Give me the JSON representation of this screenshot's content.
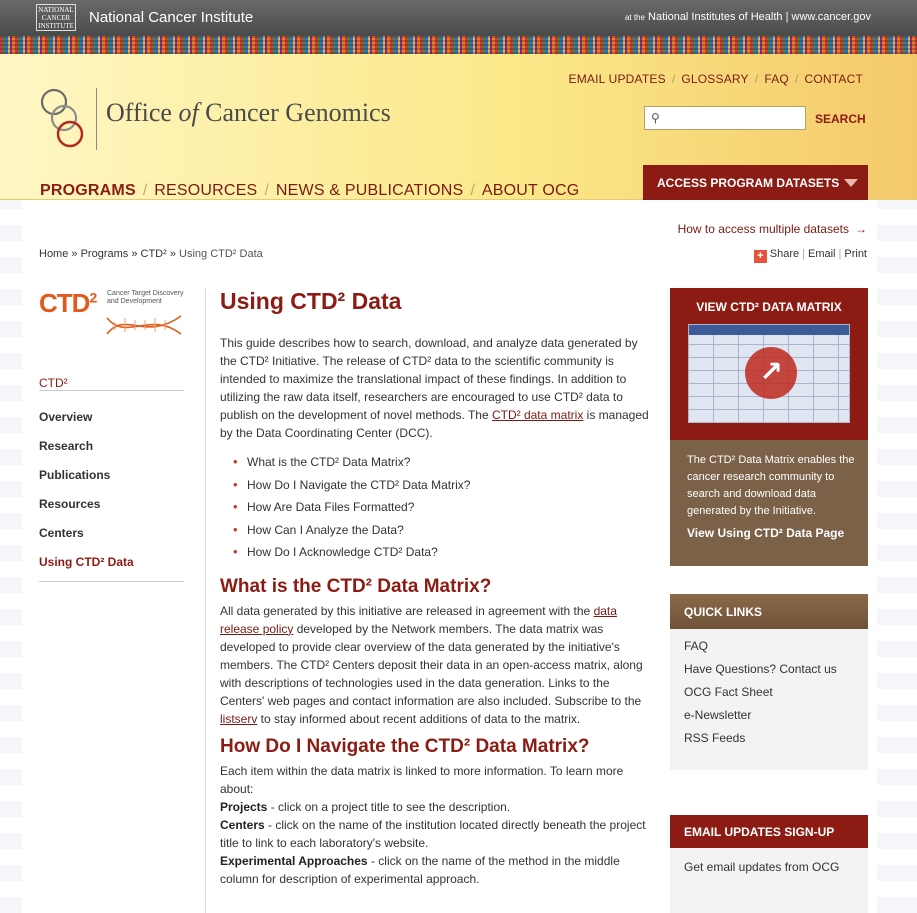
{
  "nci": {
    "logo_text": "NATIONAL CANCER INSTITUTE",
    "name": "National Cancer Institute",
    "nih_prefix": "at the",
    "nih_text": "National Institutes of Health | www.cancer.gov"
  },
  "header": {
    "utility_links": [
      "EMAIL UPDATES",
      "GLOSSARY",
      "FAQ",
      "CONTACT"
    ],
    "site_title_pre": "Office ",
    "site_title_of": "of",
    "site_title_post": " Cancer Genomics",
    "search_placeholder": "",
    "search_label": "SEARCH",
    "nav": [
      "PROGRAMS",
      "RESOURCES",
      "NEWS & PUBLICATIONS",
      "ABOUT OCG"
    ],
    "access_label": "ACCESS PROGRAM DATASETS"
  },
  "multi_link": "How to access multiple datasets",
  "breadcrumb": [
    "Home",
    "Programs",
    "CTD²",
    "Using CTD² Data"
  ],
  "share": {
    "share": "Share",
    "email": "Email",
    "print": "Print"
  },
  "left": {
    "logo_big": "CTD",
    "logo_sup": "2",
    "logo_sub": "Cancer Target Discovery and Development",
    "section_title": "CTD²",
    "items": [
      "Overview",
      "Research",
      "Publications",
      "Resources",
      "Centers",
      "Using CTD² Data"
    ]
  },
  "main": {
    "title": "Using CTD² Data",
    "intro_1": "This guide describes how to search, download, and analyze data generated by the CTD² Initiative. The release of CTD² data to the scientific community is intended to maximize the translational impact of these findings. In addition to utilizing the raw data itself, researchers are encouraged to use CTD² data to publish on the development of novel methods. The ",
    "intro_link": "CTD² data matrix",
    "intro_2": "  is managed by the Data Coordinating Center (DCC).",
    "toc": [
      "What is the CTD² Data Matrix?",
      "How Do I Navigate the CTD² Data Matrix?",
      "How Are Data Files Formatted?",
      "How Can I Analyze the Data?",
      "How Do I Acknowledge CTD² Data?"
    ],
    "h2_1": "What is the CTD² Data Matrix?",
    "p1_a": "All data generated by this initiative are released in agreement with the ",
    "p1_link": "data release policy",
    "p1_b": " developed by the Network members. The data matrix was developed to provide clear overview of the data generated by the initiative's members.  The CTD² Centers deposit their data in an open-access matrix, along with descriptions of technologies used in the data generation. Links to the Centers' web pages and contact information are also included. Subscribe to the ",
    "p1_link2": "listserv",
    "p1_c": " to stay informed about recent additions of data to the matrix.",
    "h2_2": "How Do I Navigate the CTD² Data Matrix?",
    "p2": "Each item within the data matrix is linked to more information. To learn more about:",
    "items": [
      {
        "label": "Projects",
        "text": " - click on a project title to see the description."
      },
      {
        "label": "Centers",
        "text": " - click on the name of the institution located directly beneath the project title to link to each laboratory's website."
      },
      {
        "label": "Experimental Approaches",
        "text": " - click on the name of the method in the middle column for description of experimental approach."
      }
    ]
  },
  "right": {
    "matrix_title": "VIEW CTD² DATA MATRIX",
    "matrix_desc": "The CTD² Data Matrix enables the cancer research community to search and download data generated by the Initiative.",
    "matrix_link": "View Using CTD² Data Page",
    "quick_title": "QUICK LINKS",
    "quick_links": [
      "FAQ",
      "Have Questions? Contact us",
      "OCG Fact Sheet",
      "e-Newsletter",
      "RSS Feeds"
    ],
    "email_title": "EMAIL UPDATES SIGN-UP",
    "email_text": "Get email updates from OCG"
  },
  "colors": {
    "brand_red": "#8c1c13",
    "brown": "#7a6147",
    "header_yellow": "#fbe98a"
  }
}
